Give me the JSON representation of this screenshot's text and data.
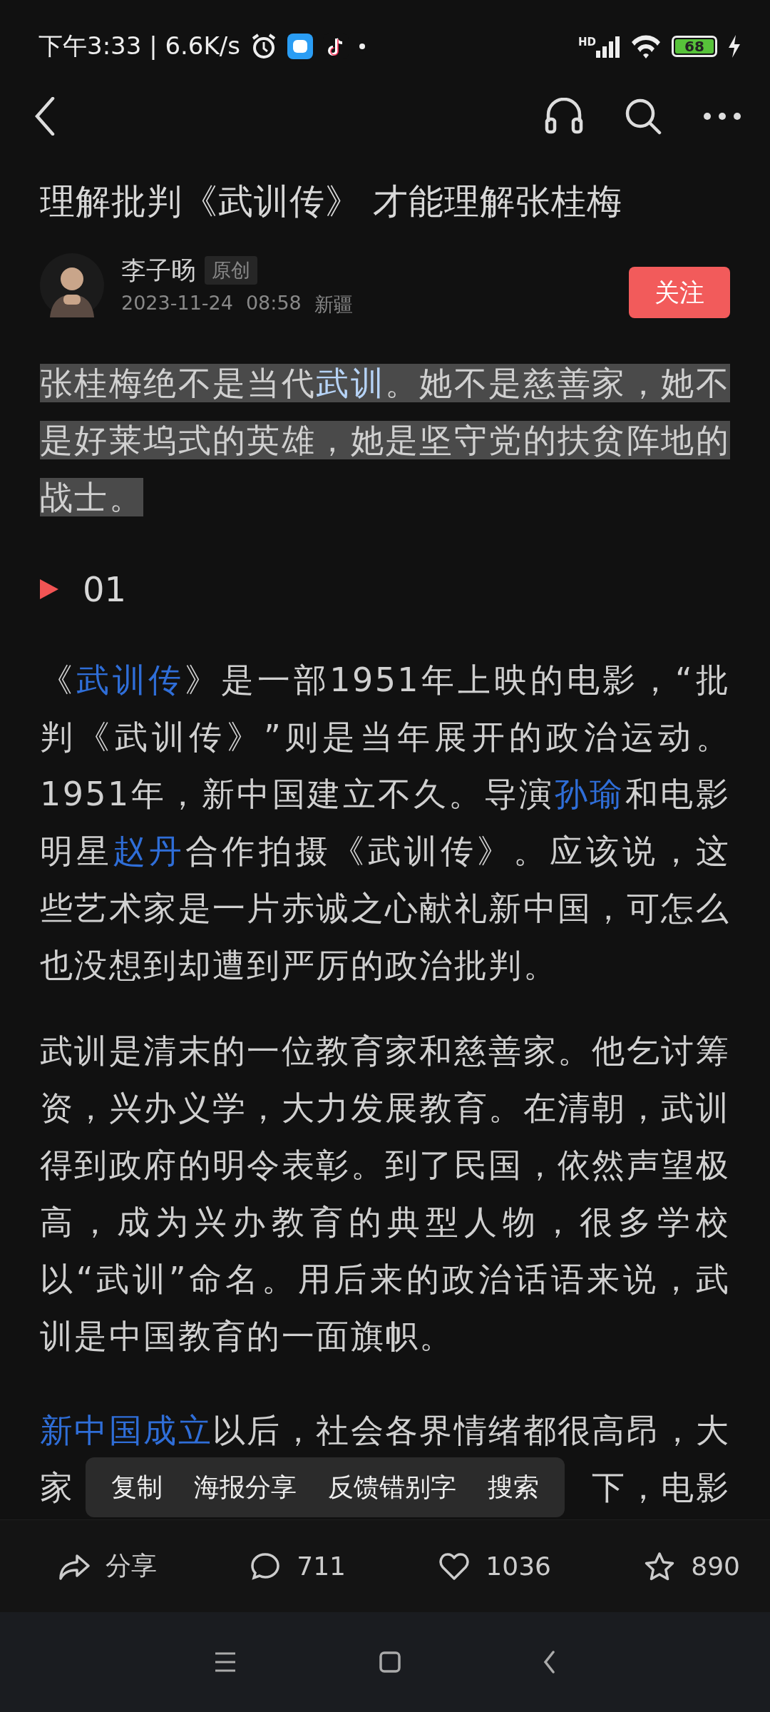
{
  "status_bar": {
    "time": "下午3:33 | 6.6K/s",
    "network_label": "HD",
    "battery": "68"
  },
  "article": {
    "title": "理解批判《武训传》 才能理解张桂梅",
    "author": {
      "name": "李子旸",
      "badge": "原创",
      "date": "2023-11-24",
      "time": "08:58",
      "location": "新疆",
      "follow_button": "关注"
    },
    "paragraphs": [
      {
        "kind": "text",
        "selected": true,
        "segments": [
          {
            "text": "张桂梅绝不是当代",
            "link": false
          },
          {
            "text": "武训",
            "link": true
          },
          {
            "text": "。她不是慈善家，她不是好莱坞式的英雄，她是坚守党的扶贫阵地的战士。",
            "link": false
          }
        ]
      },
      {
        "kind": "heading",
        "text": "01"
      },
      {
        "kind": "text",
        "selected": false,
        "segments": [
          {
            "text": "《",
            "link": false
          },
          {
            "text": "武训传",
            "link": true
          },
          {
            "text": "》是一部1951年上映的电影，“批判《武训传》”则是当年展开的政治运动。1951年，新中国建立不久。导演",
            "link": false
          },
          {
            "text": "孙瑜",
            "link": true
          },
          {
            "text": "和电影明星",
            "link": false
          },
          {
            "text": "赵丹",
            "link": true
          },
          {
            "text": "合作拍摄《武训传》。应该说，这些艺术家是一片赤诚之心献礼新中国，可怎么也没想到却遭到严厉的政治批判。",
            "link": false
          }
        ]
      },
      {
        "kind": "text",
        "selected": false,
        "segments": [
          {
            "text": "武训是清末的一位教育家和慈善家。他乞讨筹资，兴办义学，大力发展教育。在清朝，武训得到政府的明令表彰。到了民国，依然声望极高，成为兴办教育的典型人物，很多学校以“武训”命名。用后来的政治话语来说，武训是中国教育的一面旗帜。",
            "link": false
          }
        ]
      },
      {
        "kind": "covered",
        "selected": false,
        "segments": [
          {
            "text": "新中国成立",
            "link": true
          },
          {
            "text": "以后，社会各界情绪都很高昂，大",
            "link": false
          }
        ],
        "covered_line": [
          "家",
          "下，电影"
        ]
      }
    ],
    "selection_menu": [
      "复制",
      "海报分享",
      "反馈错别字",
      "搜索"
    ]
  },
  "actions": [
    {
      "kind": "share",
      "label": "分享"
    },
    {
      "kind": "comment",
      "label": "711"
    },
    {
      "kind": "like",
      "label": "1036"
    },
    {
      "kind": "favorite",
      "label": "890"
    }
  ]
}
